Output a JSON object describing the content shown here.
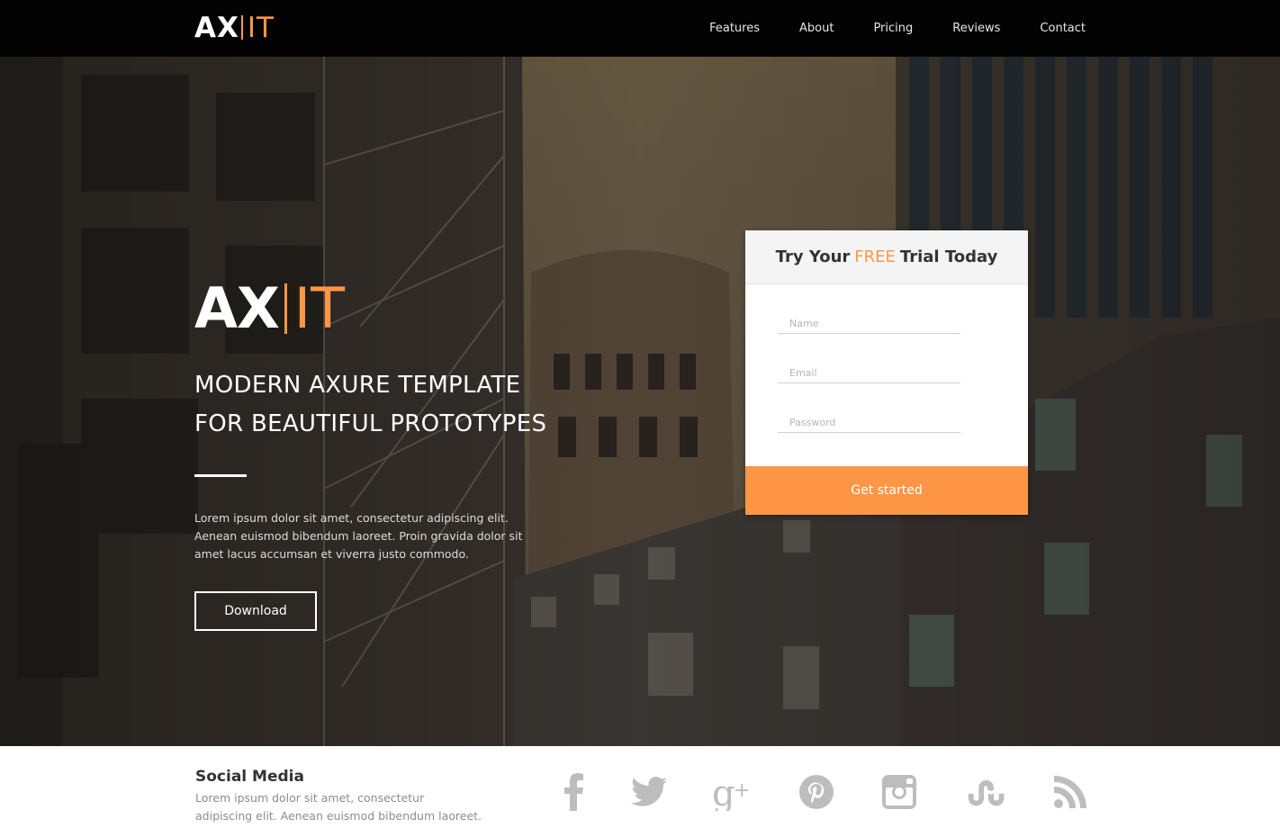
{
  "header": {
    "logo_ax": "AX",
    "logo_it": "IT",
    "nav": [
      {
        "label": "Features"
      },
      {
        "label": "About"
      },
      {
        "label": "Pricing"
      },
      {
        "label": "Reviews"
      },
      {
        "label": "Contact"
      }
    ]
  },
  "hero": {
    "logo_ax": "AX",
    "logo_it": "IT",
    "headline_line1": "MODERN AXURE TEMPLATE",
    "headline_line2": "FOR BEAUTIFUL PROTOTYPES",
    "blurb": "Lorem ipsum dolor sit amet, consectetur adipiscing elit. Aenean euismod bibendum laoreet. Proin gravida dolor sit amet lacus accumsan et viverra justo commodo.",
    "download_label": "Download"
  },
  "trial": {
    "title_pre": "Try Your",
    "title_free": "FREE",
    "title_post": "Trial Today",
    "name_placeholder": "Name",
    "email_placeholder": "Email",
    "password_placeholder": "Password",
    "submit_label": "Get started"
  },
  "footer": {
    "title": "Social Media",
    "text": "Lorem ipsum dolor sit amet, consectetur adipiscing elit. Aenean euismod bibendum laoreet.",
    "icons": [
      "facebook-icon",
      "twitter-icon",
      "google-plus-icon",
      "pinterest-icon",
      "instagram-icon",
      "stumbleupon-icon",
      "rss-icon"
    ]
  },
  "colors": {
    "accent": "#ff9646",
    "nav_bg": "#030303",
    "icon_gray": "#bdbdbd"
  }
}
